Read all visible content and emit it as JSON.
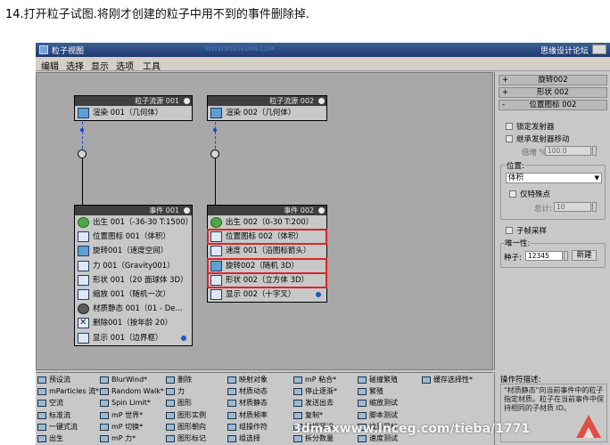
{
  "caption": {
    "step": "14.",
    "text": "打开粒子试图.将刚才创建的粒子中用不到的事件删除掉."
  },
  "window": {
    "title": "粒子视图",
    "right_title": "思缘设计论坛",
    "site_mark": "WWW.MISSVUAN.COM"
  },
  "menu": [
    "编辑",
    "选择",
    "显示",
    "选项",
    "工具"
  ],
  "nodes": [
    {
      "id": "source1",
      "header": "粒子流源 001",
      "items": [
        {
          "label": "渲染 001（几何体）",
          "icon": "render-icon"
        }
      ]
    },
    {
      "id": "source2",
      "header": "粒子流源 002",
      "items": [
        {
          "label": "渲染 002（几何体）",
          "icon": "render-icon"
        }
      ]
    },
    {
      "id": "event1",
      "header": "事件 001",
      "items": [
        {
          "label": "出生 001（-36-30 T:1500）",
          "icon": "birth-icon"
        },
        {
          "label": "位置图标 001（体积）",
          "icon": "position-icon"
        },
        {
          "label": "旋转001（速度空间）",
          "icon": "rotation-icon"
        },
        {
          "label": "力 001（Gravity001）",
          "icon": "force-icon"
        },
        {
          "label": "形状 001（20 面球体 3D）",
          "icon": "shape-icon"
        },
        {
          "label": "缩放 001（随机一次）",
          "icon": "scale-icon"
        },
        {
          "label": "材质静态 001（01 - De...",
          "icon": "material-icon"
        },
        {
          "label": "删除001（按年龄 20）",
          "icon": "delete-icon"
        },
        {
          "label": "显示 001（边界框）",
          "icon": "display-icon"
        }
      ]
    },
    {
      "id": "event2",
      "header": "事件 002",
      "items": [
        {
          "label": "出生 002（0-30 T:200）",
          "icon": "birth-icon"
        },
        {
          "label": "位置图标 002（体积）",
          "icon": "position-icon"
        },
        {
          "label": "速度 001（沿图标箭头）",
          "icon": "speed-icon"
        },
        {
          "label": "旋转002（随机 3D）",
          "icon": "rotation-icon"
        },
        {
          "label": "形状 002（立方体 3D）",
          "icon": "shape-icon"
        },
        {
          "label": "显示 002（十字叉）",
          "icon": "display-icon"
        }
      ]
    }
  ],
  "right_panel": {
    "rollouts": [
      {
        "sign": "+",
        "label": "旋转002"
      },
      {
        "sign": "+",
        "label": "形状 002"
      },
      {
        "sign": "-",
        "label": "位置图标 002"
      }
    ],
    "lock_emitter": "锁定发射器",
    "inherit_move": "继承发射器移动",
    "multiplier_label": "倍增 %",
    "multiplier_value": "100.0",
    "location_label": "位置:",
    "location_value": "体积",
    "separation": "仅特殊点",
    "total_label": "总计:",
    "total_value": "10",
    "subframe": "子帧采样",
    "unique_label": "唯一性:",
    "seed_label": "种子:",
    "seed_value": "12345",
    "new_button": "新建"
  },
  "depot": {
    "columns": [
      [
        "预设流",
        "mParticles 流*",
        "空流",
        "标准流",
        "一键式流",
        "出生"
      ],
      [
        "BlurWind*",
        "Random Walk*",
        "Spin Limit*",
        "mP 世界*",
        "mP 切换*",
        "mP 力*"
      ],
      [
        "删除",
        "力",
        "图形",
        "图形实例",
        "图形朝向",
        "图形标记"
      ],
      [
        "映射对象",
        "材质动态",
        "材质静态",
        "材质频率",
        "组操作符",
        "组选择"
      ],
      [
        "mP 粘合*",
        "停止逐渐*",
        "发送出去",
        "复制*",
        "数据预设",
        "拆分数量"
      ],
      [
        "碰撞繁殖",
        "繁殖",
        "缩放测试",
        "脚本测试",
        "找到目标",
        "速度测试"
      ],
      [
        "缓存选择性*"
      ]
    ]
  },
  "description": {
    "title": "操作符描述:",
    "text": "\"材质静态\"向当前事件中的粒子指定材质。粒子在当前事件中保持相同的子材质 ID。"
  },
  "watermark": "3dmaxwww.lnceg.com/tieba/1771"
}
